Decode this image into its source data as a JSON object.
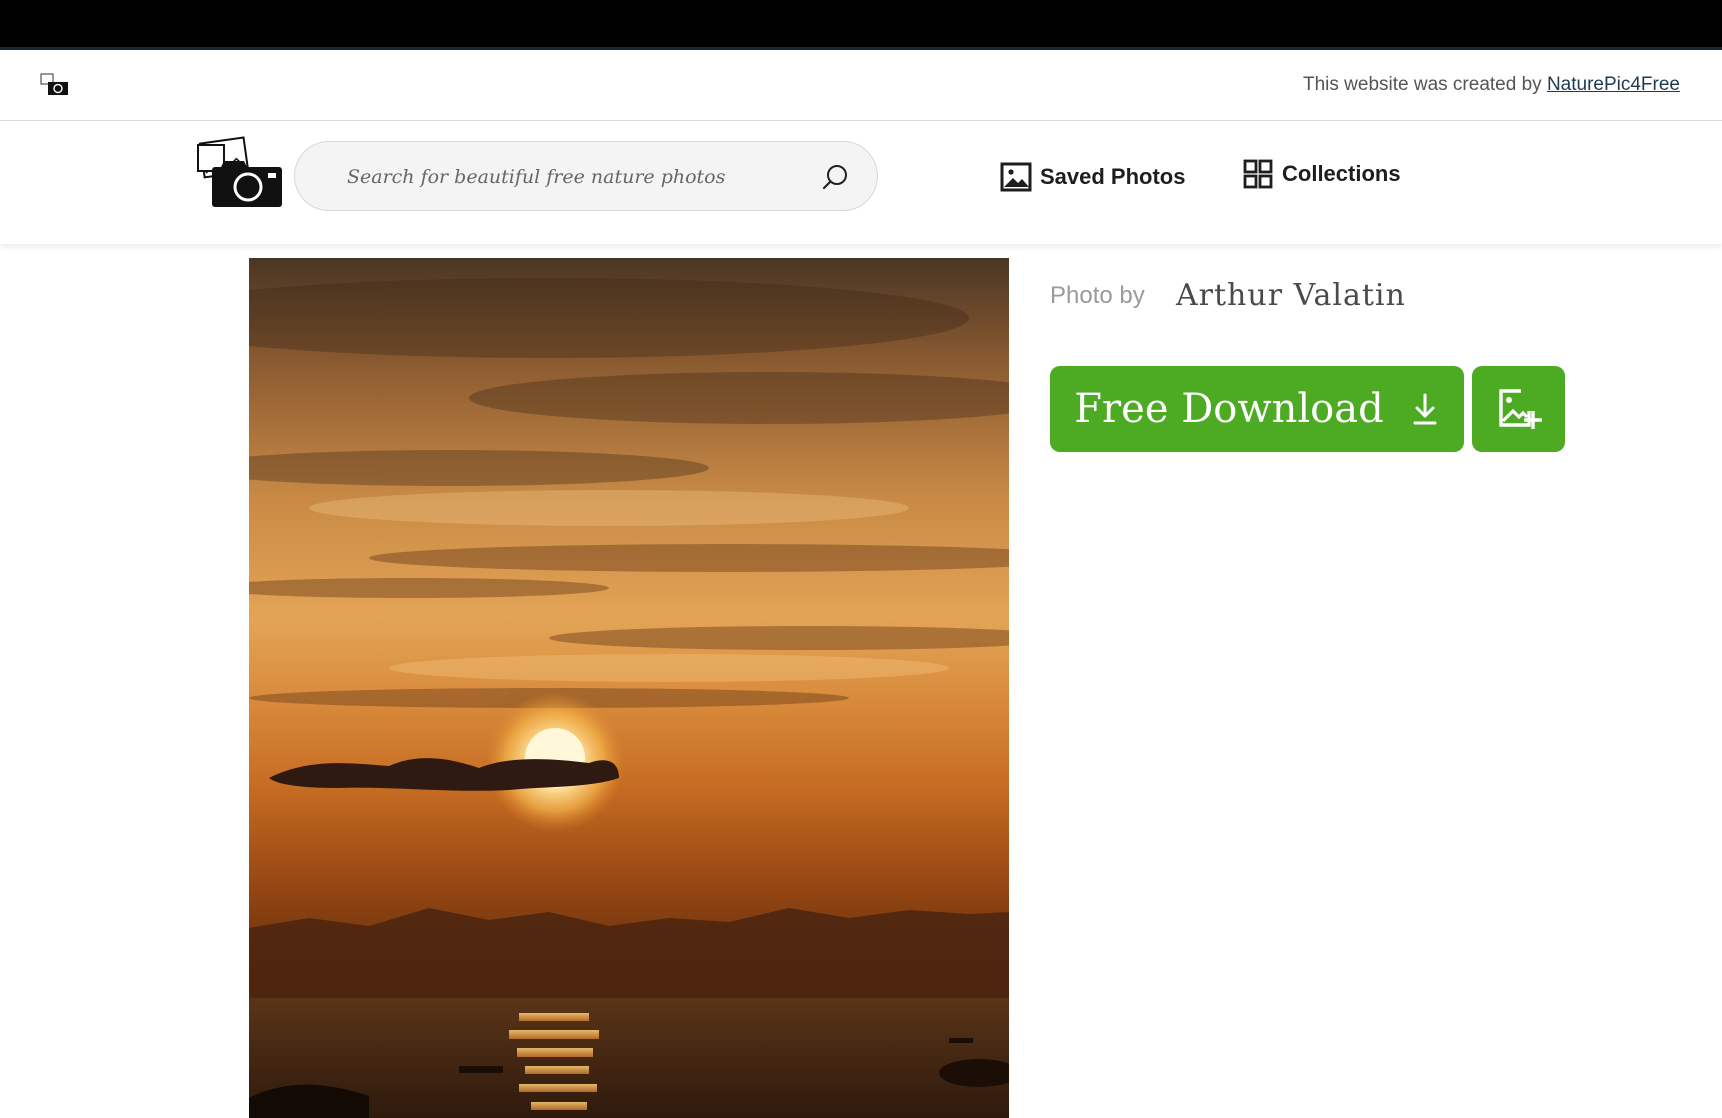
{
  "top_bar": {
    "credit_prefix": "This website was created by",
    "credit_link": "NaturePic4Free"
  },
  "header": {
    "search": {
      "placeholder": "Search for beautiful free nature photos",
      "icon": "search-icon"
    },
    "nav": [
      {
        "label": "Saved Photos",
        "icon": "image-icon"
      },
      {
        "label": "Collections",
        "icon": "grid-icon"
      }
    ]
  },
  "photo": {
    "subject": "sunset over sea",
    "credit_label": "Photo by",
    "author": "Arthur Valatin"
  },
  "actions": {
    "download_label": "Free Download",
    "download_icon": "download-arrow-icon",
    "add_icon": "add-to-collection-icon"
  },
  "colors": {
    "accent_green": "#4caa23",
    "top_bar": "#000000",
    "link": "#1e3a52"
  }
}
